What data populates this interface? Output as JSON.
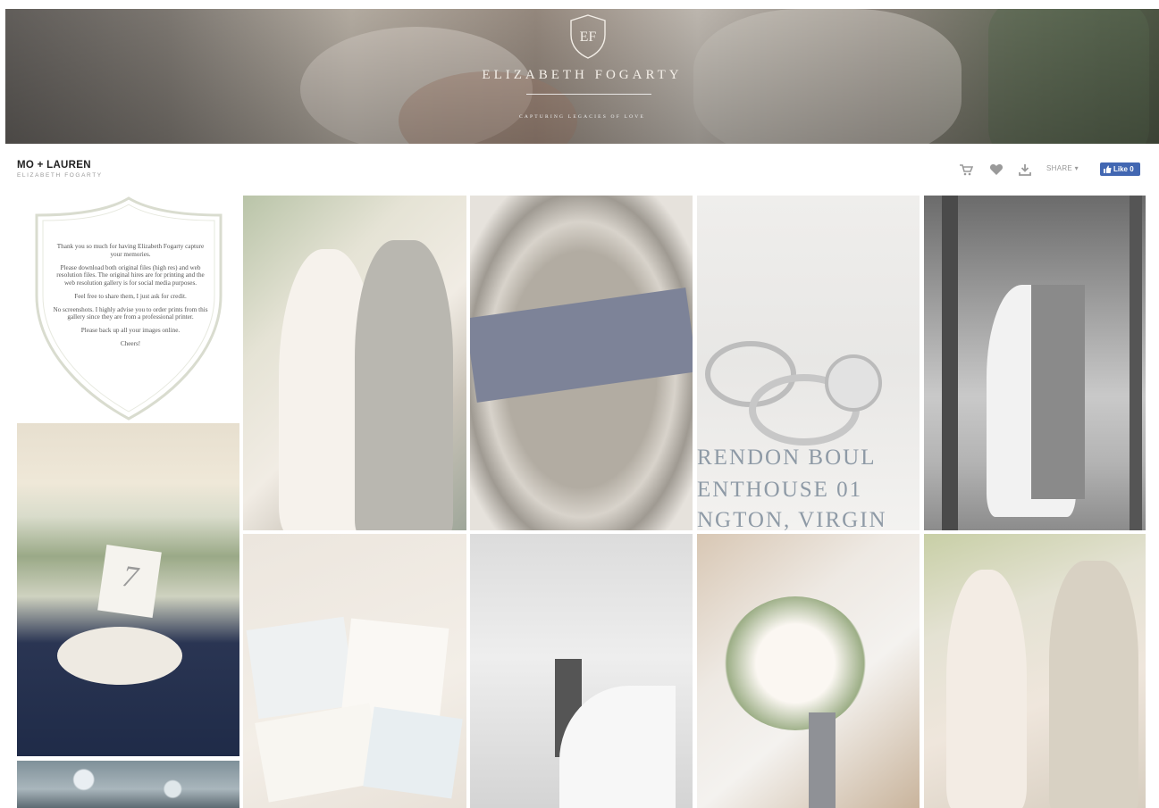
{
  "banner": {
    "brand": "ELIZABETH FOGARTY",
    "monogram": "EF",
    "tagline": "CAPTURING LEGACIES OF LOVE"
  },
  "gallery": {
    "title": "MO + LAUREN",
    "subtitle": "ELIZABETH FOGARTY"
  },
  "toolbar": {
    "cart_icon": "cart-icon",
    "favorite_icon": "heart-icon",
    "download_icon": "download-icon",
    "share_label": "SHARE ▾",
    "like_label": "Like 0"
  },
  "note": {
    "paragraphs": [
      "Thank you so much for having Elizabeth Fogarty capture your memories.",
      "Please download both original files (high res) and web resolution files. The original hires are for printing and the web resolution gallery is for social media purposes.",
      "Feel free to share them, I just ask for credit.",
      "No screenshots. I highly advise you to order prints from this gallery since they are from a professional printer.",
      "Please back up all your images online.",
      "Cheers!"
    ]
  },
  "photos": {
    "rings_card_lines": [
      "RENDON BOUL",
      "ENTHOUSE 01",
      "NGTON, VIRGIN"
    ],
    "table_number": "7"
  },
  "colors": {
    "like_button": "#4267b2",
    "icon_gray": "#9a9a9a",
    "crest_stroke": "#cfd3c4"
  }
}
